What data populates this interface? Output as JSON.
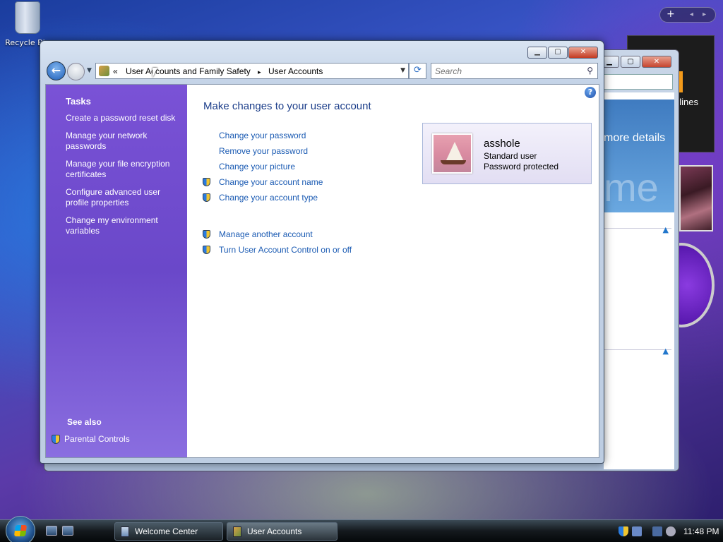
{
  "desktop": {
    "recycle_bin_label": "Recycle Bin"
  },
  "gadgets": {
    "feed_text": "dlines",
    "bar_buttons": [
      "+",
      "◂",
      "▸"
    ]
  },
  "background_window": {
    "header_text": "more details",
    "header_big_text": "me"
  },
  "window": {
    "title": "User Accounts",
    "controls": {
      "minimize": "▁",
      "maximize": "▢",
      "close": "✕"
    },
    "address": {
      "overflow": "«",
      "crumbs": [
        "User Accounts and Family Safety",
        "User Accounts"
      ],
      "separator": "▸"
    },
    "search": {
      "placeholder": "Search"
    },
    "sidebar": {
      "title": "Tasks",
      "tasks": [
        "Create a password reset disk",
        "Manage your network passwords",
        "Manage your file encryption certificates",
        "Configure advanced user profile properties",
        "Change my environment variables"
      ],
      "see_also_title": "See also",
      "see_also_items": [
        "Parental Controls"
      ]
    },
    "main": {
      "heading": "Make changes to your user account",
      "links": [
        {
          "label": "Change your password",
          "shield": false
        },
        {
          "label": "Remove your password",
          "shield": false
        },
        {
          "label": "Change your picture",
          "shield": false
        },
        {
          "label": "Change your account name",
          "shield": true
        },
        {
          "label": "Change your account type",
          "shield": true
        }
      ],
      "links2": [
        {
          "label": "Manage another account",
          "shield": true
        },
        {
          "label": "Turn User Account Control on or off",
          "shield": true
        }
      ],
      "user": {
        "name": "asshole",
        "type": "Standard user",
        "password_status": "Password protected"
      }
    }
  },
  "taskbar": {
    "buttons": [
      "Welcome Center",
      "User Accounts"
    ],
    "active_button": "User Accounts",
    "clock": "11:48 PM"
  },
  "colors": {
    "sidebar": "#7a52d6",
    "link": "#1b5bb3",
    "heading": "#1c3e8a"
  }
}
